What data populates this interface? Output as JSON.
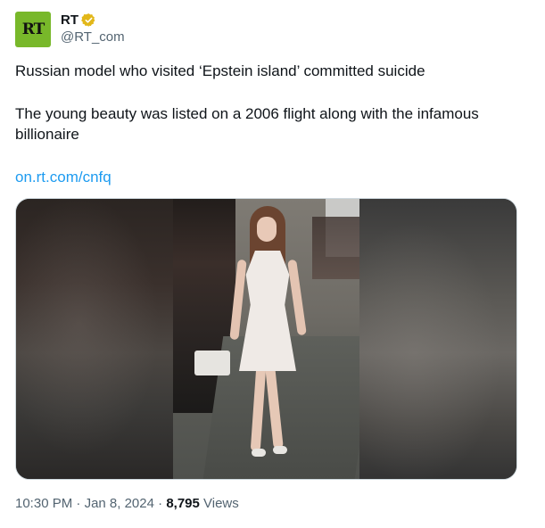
{
  "author": {
    "avatar_text": "RT",
    "display_name": "RT",
    "handle": "@RT_com",
    "verified": true,
    "avatar_color": "#78b82a",
    "verified_color": "#e2b719"
  },
  "tweet": {
    "line1": "Russian model who visited ‘Epstein island’ committed suicide",
    "line2": "The young beauty was listed on a 2006 flight along with the infamous billionaire",
    "link": "on.rt.com/cnfq",
    "link_color": "#1d9bf0"
  },
  "media": {
    "icon": "photo-image"
  },
  "meta": {
    "time": "10:30 PM",
    "separator": " · ",
    "date": "Jan 8, 2024",
    "views_count": "8,795",
    "views_label": " Views"
  }
}
